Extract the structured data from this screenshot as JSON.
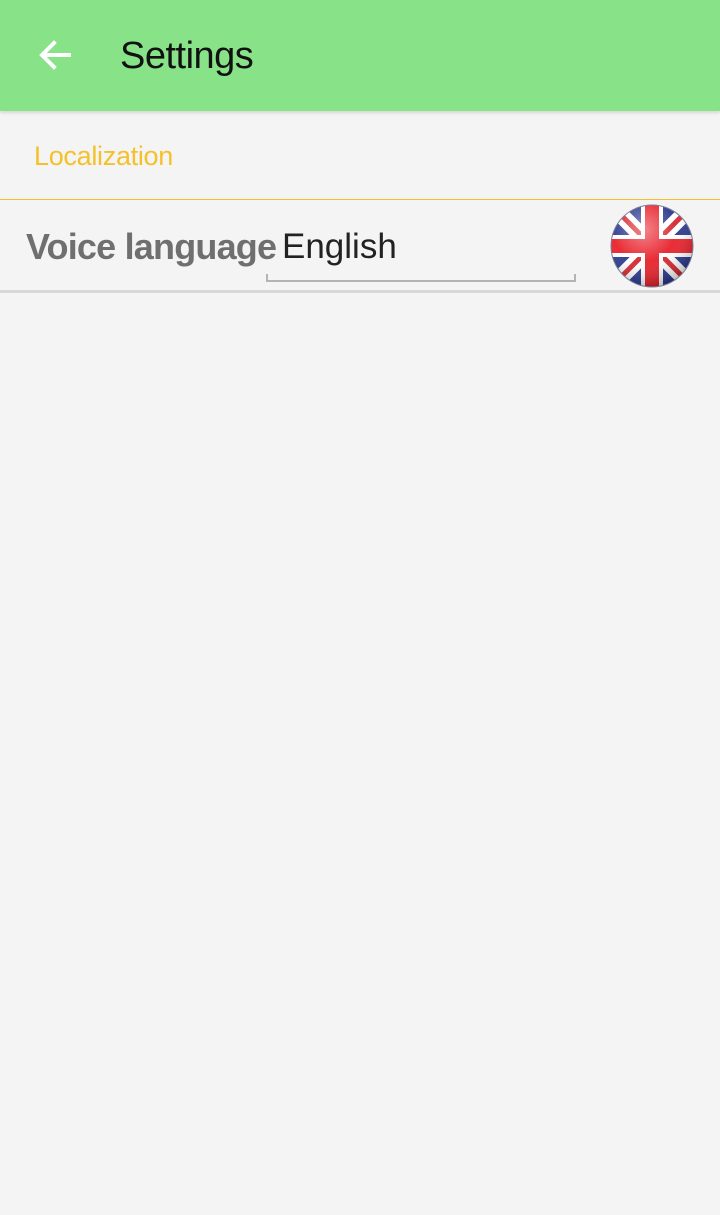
{
  "app_bar": {
    "title": "Settings",
    "back_icon": "arrow-back-icon",
    "background_color": "#88e288"
  },
  "localization": {
    "section_title": "Localization",
    "accent_color": "#f5c12a",
    "voice_language": {
      "label": "Voice language",
      "selected_value": "English",
      "flag_icon": "uk-flag-icon"
    }
  }
}
